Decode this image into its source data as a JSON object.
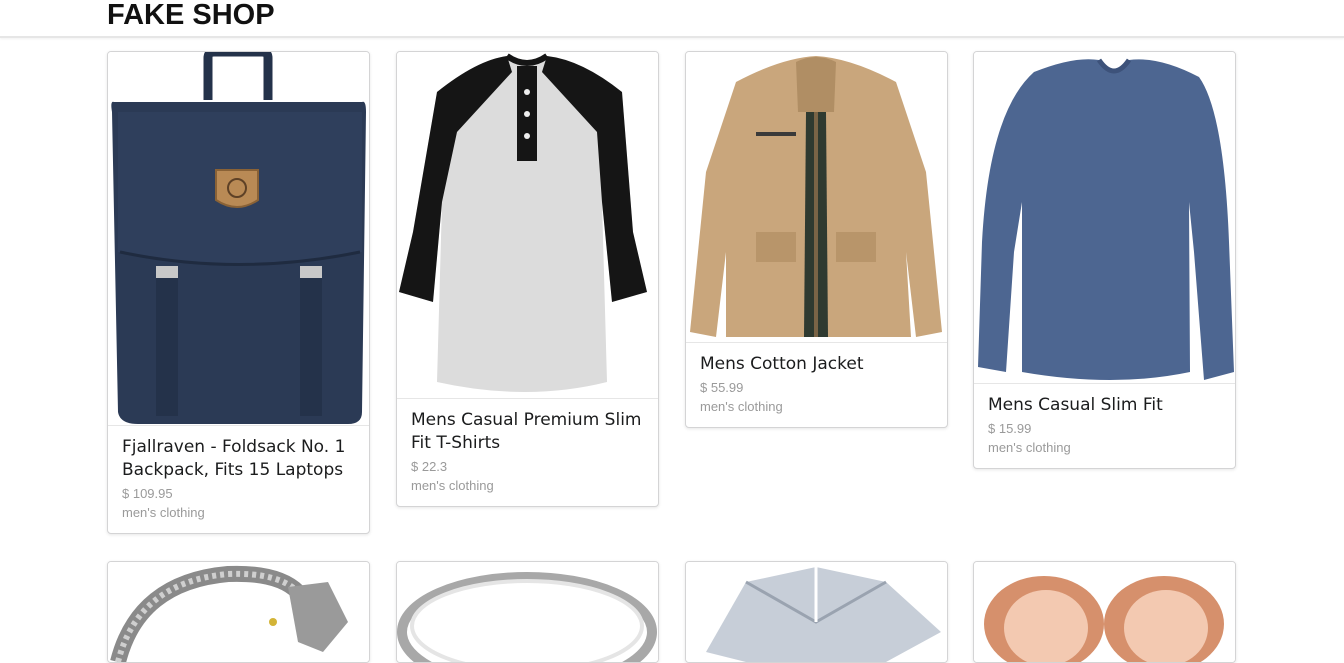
{
  "header": {
    "logo": "FAKE SHOP"
  },
  "products": [
    {
      "title": "Fjallraven - Foldsack No. 1 Backpack, Fits 15 Laptops",
      "price": "$ 109.95",
      "category": "men's clothing",
      "image": "backpack-image"
    },
    {
      "title": "Mens Casual Premium Slim Fit T-Shirts",
      "price": "$ 22.3",
      "category": "men's clothing",
      "image": "raglan-tshirt-image"
    },
    {
      "title": "Mens Cotton Jacket",
      "price": "$ 55.99",
      "category": "men's clothing",
      "image": "cotton-jacket-image"
    },
    {
      "title": "Mens Casual Slim Fit",
      "price": "$ 15.99",
      "category": "men's clothing",
      "image": "longsleeve-shirt-image"
    },
    {
      "title": "",
      "price": "",
      "category": "",
      "image": "dragon-bracelet-image"
    },
    {
      "title": "",
      "price": "",
      "category": "",
      "image": "silver-ring-image"
    },
    {
      "title": "",
      "price": "",
      "category": "",
      "image": "diamond-ring-image"
    },
    {
      "title": "",
      "price": "",
      "category": "",
      "image": "rose-gold-plugs-image"
    }
  ]
}
